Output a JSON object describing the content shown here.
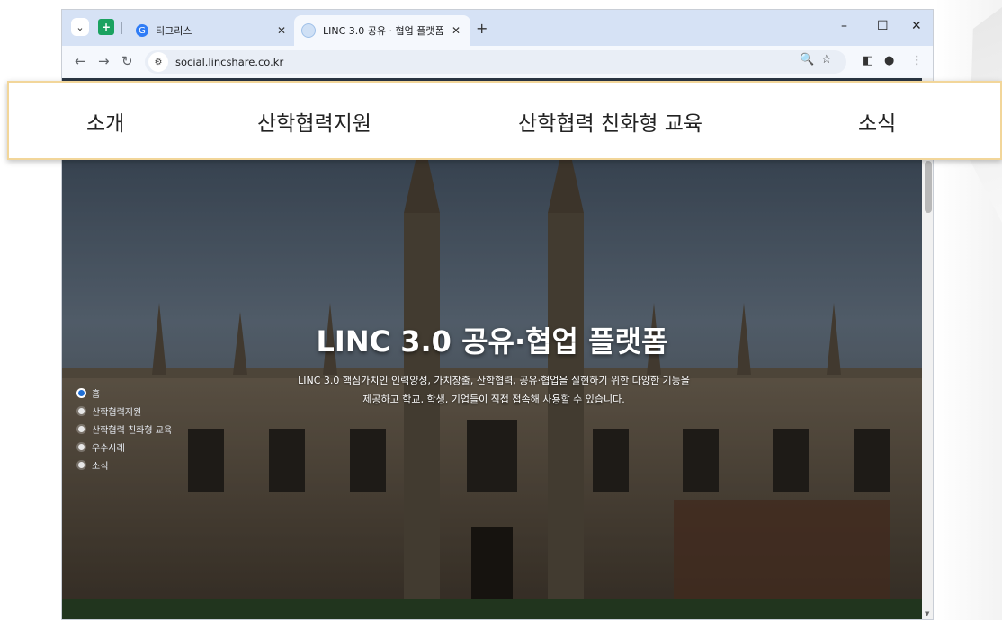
{
  "browser": {
    "tabs": [
      {
        "title": "티그리스",
        "active": false
      },
      {
        "title": "LINC 3.0 공유 · 협업 플랫폼",
        "active": true
      }
    ],
    "url": "social.lincshare.co.kr"
  },
  "top_nav": {
    "items": [
      "소개",
      "산학협력지원",
      "산학협력 친화형 교육",
      "소식"
    ]
  },
  "hero": {
    "title": "LINC 3.0 공유·협업 플랫폼",
    "description_line1": "LINC 3.0 핵심가치인 인력양성, 가치창출, 산학협력, 공유·협업을 실현하기 위한 다양한 기능을",
    "description_line2": "제공하고 학교, 학생, 기업들이 직접 접속해 사용할 수 있습니다."
  },
  "side_nav": {
    "items": [
      "홈",
      "산학협력지원",
      "산학협력 친화형 교육",
      "우수사례",
      "소식"
    ],
    "active_index": 0
  },
  "colors": {
    "active_dot": "#1f6fd6",
    "highlight_border": "#f2d69a"
  },
  "icons": [
    "tab-list-icon",
    "pinned-tab-icon",
    "favicon-tigris",
    "favicon-linc",
    "close-icon",
    "new-tab-icon",
    "minimize-icon",
    "maximize-icon",
    "close-window-icon",
    "back-icon",
    "forward-icon",
    "reload-icon",
    "site-info-icon",
    "zoom-icon",
    "bookmark-star-icon",
    "side-panel-icon",
    "profile-icon",
    "menu-kebab-icon"
  ]
}
